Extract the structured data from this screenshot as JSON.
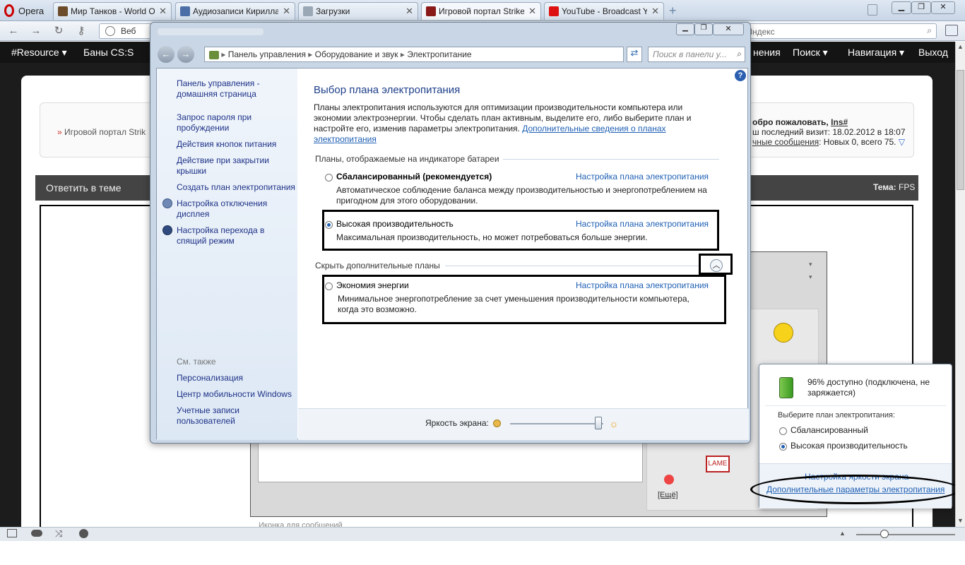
{
  "browser": {
    "menu_label": "Opera",
    "tabs": [
      {
        "label": "Мир Танков - World O...",
        "color": "#6b4b2a"
      },
      {
        "label": "Аудиозаписи Кирилла...",
        "color": "#4a6ea5"
      },
      {
        "label": "Загрузки",
        "color": "#9aa7b5"
      },
      {
        "label": "Игровой портал Strike...",
        "color": "#8a1a1a"
      },
      {
        "label": "YouTube - Broadcast Y...",
        "color": "#d11"
      }
    ],
    "address_label": "Веб",
    "search_placeholder": "ь в Яндекс"
  },
  "site": {
    "nav": {
      "resource": "#Resource",
      "bans": "Баны CS:S",
      "help": "нения",
      "search": "Поиск",
      "navigation": "Навигация",
      "exit": "Выход"
    },
    "portal": "Игровой портал Strik",
    "welcome": "обро пожаловать,",
    "username": "Ins#",
    "last_visit": "ш последний визит: 18.02.2012 в 18:07",
    "messages_link": "чные сообщения",
    "messages_rest": ": Новых 0, всего 75.",
    "reply": "Ответить в теме",
    "topic_label": "Тема:",
    "topic": "FPS",
    "more": "[Ещё]",
    "bottom_text": "Иконка для сообщений"
  },
  "window": {
    "breadcrumb": [
      "Панель управления",
      "Оборудование и звук",
      "Электропитание"
    ],
    "search_placeholder": "Поиск в панели у...",
    "help": "?",
    "sidebar": {
      "home_line1": "Панель управления -",
      "home_line2": "домашняя страница",
      "links": [
        [
          "Запрос пароля при",
          "пробуждении"
        ],
        [
          "Действия кнопок питания",
          ""
        ],
        [
          "Действие при закрытии",
          "крышки"
        ],
        [
          "Создать план электропитания",
          ""
        ],
        [
          "Настройка отключения",
          "дисплея"
        ],
        [
          "Настройка перехода в",
          "спящий режим"
        ]
      ],
      "see_also": "См. также",
      "also_links": [
        [
          "Персонализация",
          ""
        ],
        [
          "Центр мобильности Windows",
          ""
        ],
        [
          "Учетные записи",
          "пользователей"
        ]
      ]
    },
    "title": "Выбор плана электропитания",
    "intro_1": "Планы электропитания используются для оптимизации производительности компьютера или",
    "intro_2": "экономии электроэнергии. Чтобы сделать план активным, выделите его, либо выберите план и",
    "intro_3": "настройте его, изменив параметры электропитания.",
    "intro_link_1": "Дополнительные сведения о планах",
    "intro_link_2": "электропитания",
    "group_label": "Планы, отображаемые на индикаторе батареи",
    "hidden_label": "Скрыть дополнительные планы",
    "plan_link": "Настройка плана электропитания",
    "plans": [
      {
        "name": "Сбалансированный (рекомендуется)",
        "desc1": "Автоматическое соблюдение баланса между производительностью и энергопотреблением на",
        "desc2": "пригодном для этого оборудовании.",
        "selected": false
      },
      {
        "name": "Высокая производительность",
        "desc1": "Максимальная производительность, но может потребоваться больше энергии.",
        "desc2": "",
        "selected": true
      },
      {
        "name": "Экономия энергии",
        "desc1": "Минимальное энергопотребление за счет уменьшения производительности компьютера,",
        "desc2": "когда это возможно.",
        "selected": false
      }
    ],
    "brightness_label": "Яркость экрана:",
    "brightness": 0.95
  },
  "tray": {
    "status_1": "96% доступно (подключена, не",
    "status_2": "заряжается)",
    "choose": "Выберите план электропитания:",
    "plans": [
      "Сбалансированный",
      "Высокая производительность"
    ],
    "selected": 1,
    "brightness_link": "Настройка яркости экрана",
    "more_link": "Дополнительные параметры электропитания"
  }
}
